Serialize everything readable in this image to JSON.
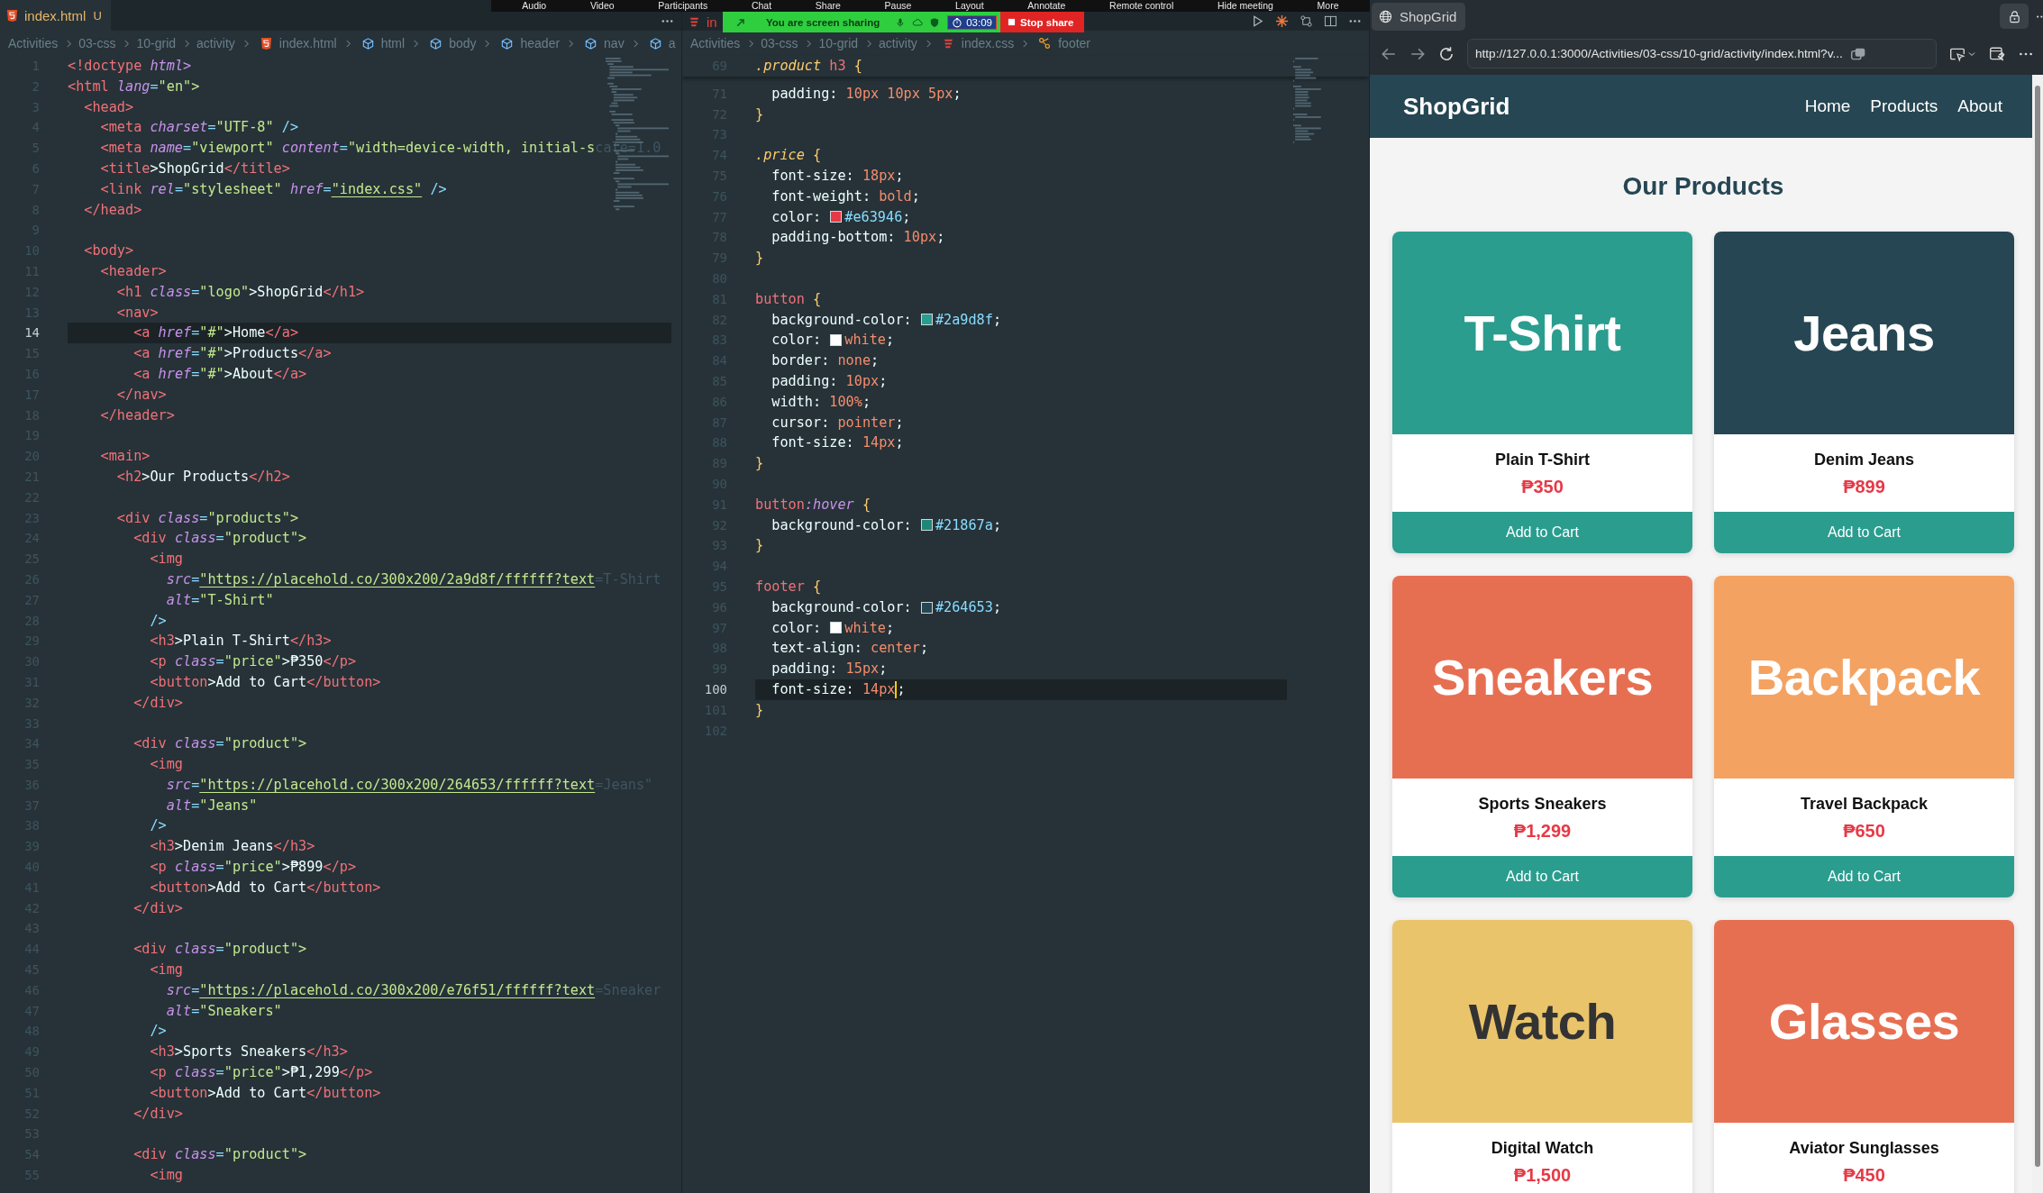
{
  "meeting": {
    "controls": [
      "Audio",
      "Video",
      "Participants",
      "Chat",
      "Share",
      "Pause",
      "Layout",
      "Annotate",
      "Remote control",
      "Hide meeting",
      "More"
    ],
    "sharing": "You are screen sharing",
    "timer": "03:09",
    "stop": "Stop share"
  },
  "editors": [
    {
      "kind": "html",
      "focused": false,
      "tab": {
        "label": "index.html",
        "badge": "U"
      },
      "breadcrumb": [
        {
          "label": "Activities",
          "kind": "folder"
        },
        {
          "label": "03-css",
          "kind": "folder"
        },
        {
          "label": "10-grid",
          "kind": "folder"
        },
        {
          "label": "activity",
          "kind": "folder"
        },
        {
          "label": "index.html",
          "kind": "html"
        },
        {
          "label": "html",
          "kind": "element"
        },
        {
          "label": "body",
          "kind": "element"
        },
        {
          "label": "header",
          "kind": "element"
        },
        {
          "label": "nav",
          "kind": "element"
        },
        {
          "label": "a",
          "kind": "element"
        }
      ],
      "lines": [
        {
          "n": "1",
          "code": "<!doctype html>",
          "current": false
        },
        {
          "n": "2",
          "code": "<html lang=\"en\">",
          "current": false
        },
        {
          "n": "3",
          "code": "  <head>",
          "current": false
        },
        {
          "n": "4",
          "code": "    <meta charset=\"UTF-8\" />",
          "current": false
        },
        {
          "n": "5",
          "code": "    <meta name=\"viewport\" content=\"width=device-width, initial-s",
          "ghost": "cale=1.0",
          "current": false
        },
        {
          "n": "6",
          "code": "    <title>ShopGrid</title>",
          "current": false
        },
        {
          "n": "7",
          "code": "    <link rel=\"stylesheet\" href=\"index.css\" />",
          "current": false
        },
        {
          "n": "8",
          "code": "  </head>",
          "current": false
        },
        {
          "n": "9",
          "current": false
        },
        {
          "n": "10",
          "code": "  <body>",
          "current": false
        },
        {
          "n": "11",
          "code": "    <header>",
          "current": false
        },
        {
          "n": "12",
          "code": "      <h1 class=\"logo\">ShopGrid</h1>",
          "current": false
        },
        {
          "n": "13",
          "code": "      <nav>",
          "current": false
        },
        {
          "n": "14",
          "code": "        <a href=\"#\">Home</a>",
          "current": true
        },
        {
          "n": "15",
          "code": "        <a href=\"#\">Products</a>",
          "current": false
        },
        {
          "n": "16",
          "code": "        <a href=\"#\">About</a>",
          "current": false
        },
        {
          "n": "17",
          "code": "      </nav>",
          "current": false
        },
        {
          "n": "18",
          "code": "    </header>",
          "current": false
        },
        {
          "n": "19",
          "current": false
        },
        {
          "n": "20",
          "code": "    <main>",
          "current": false
        },
        {
          "n": "21",
          "code": "      <h2>Our Products</h2>",
          "current": false
        },
        {
          "n": "22",
          "current": false
        },
        {
          "n": "23",
          "code": "      <div class=\"products\">",
          "current": false
        },
        {
          "n": "24",
          "code": "        <div class=\"product\">",
          "current": false
        },
        {
          "n": "25",
          "code": "          <img",
          "current": false
        },
        {
          "n": "26",
          "code": "            src=\"https://placehold.co/300x200/2a9d8f/ffffff?text",
          "ghost": "=T-Shirt",
          "current": false
        },
        {
          "n": "27",
          "code": "            alt=\"T-Shirt\"",
          "current": false
        },
        {
          "n": "28",
          "code": "          />",
          "current": false
        },
        {
          "n": "29",
          "code": "          <h3>Plain T-Shirt</h3>",
          "current": false
        },
        {
          "n": "30",
          "code": "          <p class=\"price\">₱350</p>",
          "current": false
        },
        {
          "n": "31",
          "code": "          <button>Add to Cart</button>",
          "current": false
        },
        {
          "n": "32",
          "code": "        </div>",
          "current": false
        },
        {
          "n": "33",
          "current": false
        },
        {
          "n": "34",
          "code": "        <div class=\"product\">",
          "current": false
        },
        {
          "n": "35",
          "code": "          <img",
          "current": false
        },
        {
          "n": "36",
          "code": "            src=\"https://placehold.co/300x200/264653/ffffff?text",
          "ghost": "=Jeans\"",
          "current": false
        },
        {
          "n": "37",
          "code": "            alt=\"Jeans\"",
          "current": false
        },
        {
          "n": "38",
          "code": "          />",
          "current": false
        },
        {
          "n": "39",
          "code": "          <h3>Denim Jeans</h3>",
          "current": false
        },
        {
          "n": "40",
          "code": "          <p class=\"price\">₱899</p>",
          "current": false
        },
        {
          "n": "41",
          "code": "          <button>Add to Cart</button>",
          "current": false
        },
        {
          "n": "42",
          "code": "        </div>",
          "current": false
        },
        {
          "n": "43",
          "current": false
        },
        {
          "n": "44",
          "code": "        <div class=\"product\">",
          "current": false
        },
        {
          "n": "45",
          "code": "          <img",
          "current": false
        },
        {
          "n": "46",
          "code": "            src=\"https://placehold.co/300x200/e76f51/ffffff?text",
          "ghost": "=Sneaker",
          "current": false
        },
        {
          "n": "47",
          "code": "            alt=\"Sneakers\"",
          "current": false
        },
        {
          "n": "48",
          "code": "          />",
          "current": false
        },
        {
          "n": "49",
          "code": "          <h3>Sports Sneakers</h3>",
          "current": false
        },
        {
          "n": "50",
          "code": "          <p class=\"price\">₱1,299</p>",
          "current": false
        },
        {
          "n": "51",
          "code": "          <button>Add to Cart</button>",
          "current": false
        },
        {
          "n": "52",
          "code": "        </div>",
          "current": false
        },
        {
          "n": "53",
          "current": false
        },
        {
          "n": "54",
          "code": "        <div class=\"product\">",
          "current": false
        },
        {
          "n": "55",
          "code": "          <img",
          "current": false
        }
      ]
    },
    {
      "kind": "css",
      "focused": true,
      "tab": {
        "label": "in"
      },
      "breadcrumb": [
        {
          "label": "Activities",
          "kind": "folder"
        },
        {
          "label": "03-css",
          "kind": "folder"
        },
        {
          "label": "10-grid",
          "kind": "folder"
        },
        {
          "label": "activity",
          "kind": "folder"
        },
        {
          "label": "index.css",
          "kind": "css"
        },
        {
          "label": "footer",
          "kind": "selector"
        }
      ],
      "sticky": {
        "n": "69",
        "code": ".product h3 {"
      },
      "lines": [
        {
          "n": "71",
          "code": "  padding: 10px 10px 5px;",
          "current": false
        },
        {
          "n": "72",
          "code": "}",
          "current": false
        },
        {
          "n": "73",
          "current": false
        },
        {
          "n": "74",
          "code": ".price {",
          "current": false
        },
        {
          "n": "75",
          "code": "  font-size: 18px;",
          "current": false
        },
        {
          "n": "76",
          "code": "  font-weight: bold;",
          "current": false
        },
        {
          "n": "77",
          "code": "  color: #e63946;",
          "color": "#e63946",
          "current": false
        },
        {
          "n": "78",
          "code": "  padding-bottom: 10px;",
          "current": false
        },
        {
          "n": "79",
          "code": "}",
          "current": false
        },
        {
          "n": "80",
          "current": false
        },
        {
          "n": "81",
          "code": "button {",
          "current": false
        },
        {
          "n": "82",
          "code": "  background-color: #2a9d8f;",
          "color": "#2a9d8f",
          "current": false
        },
        {
          "n": "83",
          "code": "  color: white;",
          "color": "#ffffff",
          "current": false
        },
        {
          "n": "84",
          "code": "  border: none;",
          "current": false
        },
        {
          "n": "85",
          "code": "  padding: 10px;",
          "current": false
        },
        {
          "n": "86",
          "code": "  width: 100%;",
          "current": false
        },
        {
          "n": "87",
          "code": "  cursor: pointer;",
          "current": false
        },
        {
          "n": "88",
          "code": "  font-size: 14px;",
          "current": false
        },
        {
          "n": "89",
          "code": "}",
          "current": false
        },
        {
          "n": "90",
          "current": false
        },
        {
          "n": "91",
          "code": "button:hover {",
          "current": false
        },
        {
          "n": "92",
          "code": "  background-color: #21867a;",
          "color": "#21867a",
          "current": false
        },
        {
          "n": "93",
          "code": "}",
          "current": false
        },
        {
          "n": "94",
          "current": false
        },
        {
          "n": "95",
          "code": "footer {",
          "current": false
        },
        {
          "n": "96",
          "code": "  background-color: #264653;",
          "color": "#264653",
          "current": false
        },
        {
          "n": "97",
          "code": "  color: white;",
          "color": "#ffffff",
          "current": false
        },
        {
          "n": "98",
          "code": "  text-align: center;",
          "current": false
        },
        {
          "n": "99",
          "code": "  padding: 15px;",
          "current": false
        },
        {
          "n": "100",
          "code": "  font-size: 14px;",
          "current": true
        },
        {
          "n": "101",
          "code": "}",
          "current": false
        },
        {
          "n": "102",
          "current": false
        }
      ]
    }
  ],
  "browser": {
    "tab": {
      "title": "ShopGrid"
    },
    "url": "http://127.0.0.1:3000/Activities/03-css/10-grid/activity/index.html?v...",
    "page": {
      "logo": "ShopGrid",
      "nav": [
        "Home",
        "Products",
        "About"
      ],
      "heading": "Our Products",
      "products": [
        {
          "image_text": "T-Shirt",
          "color": "#2a9d8f",
          "dark_label": false,
          "name": "Plain T-Shirt",
          "price": "₱350",
          "button": "Add to Cart"
        },
        {
          "image_text": "Jeans",
          "color": "#264653",
          "dark_label": false,
          "name": "Denim Jeans",
          "price": "₱899",
          "button": "Add to Cart"
        },
        {
          "image_text": "Sneakers",
          "color": "#e76f51",
          "dark_label": false,
          "name": "Sports Sneakers",
          "price": "₱1,299",
          "button": "Add to Cart"
        },
        {
          "image_text": "Backpack",
          "color": "#f4a261",
          "dark_label": false,
          "name": "Travel Backpack",
          "price": "₱650",
          "button": "Add to Cart"
        },
        {
          "image_text": "Watch",
          "color": "#e9c46a",
          "dark_label": true,
          "name": "Digital Watch",
          "price": "₱1,500"
        },
        {
          "image_text": "Glasses",
          "color": "#e76f51",
          "dark_label": false,
          "name": "Aviator Sunglasses",
          "price": "₱450"
        }
      ]
    }
  }
}
